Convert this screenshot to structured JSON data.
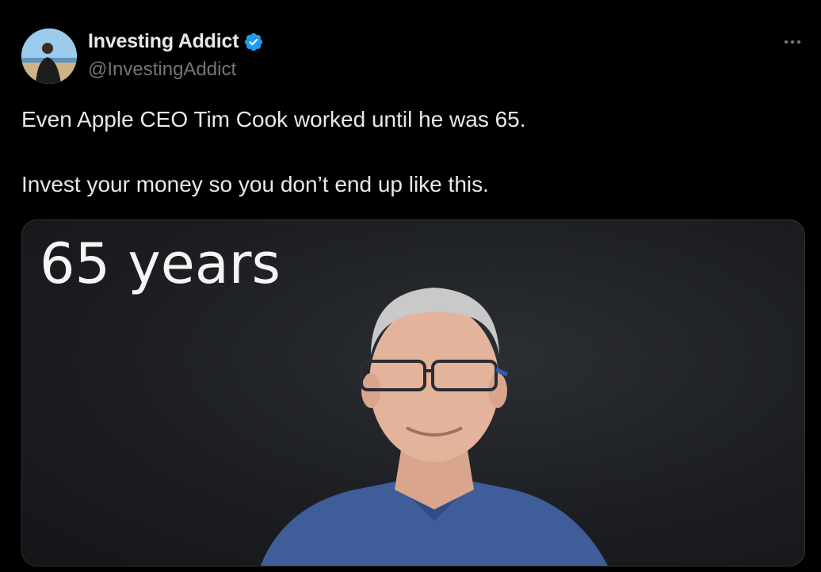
{
  "author": {
    "display_name": "Investing Addict",
    "handle": "@InvestingAddict",
    "verified": true,
    "verified_color": "#1d9bf0"
  },
  "tweet": {
    "line1": "Even Apple CEO Tim Cook worked until he was 65.",
    "line2": "Invest your money so you don’t end up like this."
  },
  "media": {
    "overlay_text": "65 years"
  },
  "icons": {
    "more": "more-horizontal-icon",
    "verified": "verified-badge-icon"
  }
}
